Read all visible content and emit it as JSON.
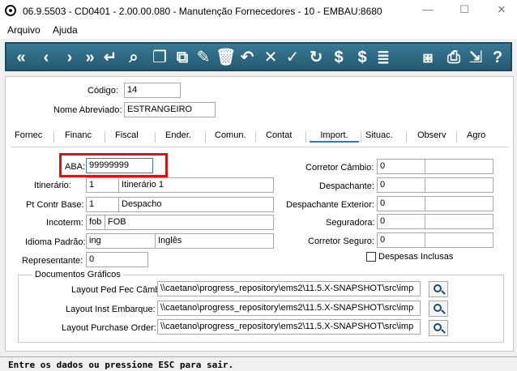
{
  "window": {
    "title": "06.9.5503 - CD0401 - 2.00.00.080 - Manutenção Fornecedores - 10 - EMBAU:8680",
    "minimize": "—",
    "maximize": "☐",
    "close": "✕"
  },
  "menu": {
    "file": "Arquivo",
    "help": "Ajuda"
  },
  "toolbar": {
    "buttons": [
      {
        "icon": "first-record-icon",
        "glyph": "«"
      },
      {
        "icon": "previous-record-icon",
        "glyph": "‹"
      },
      {
        "icon": "next-record-icon",
        "glyph": "›"
      },
      {
        "icon": "last-record-icon",
        "glyph": "»"
      },
      {
        "icon": "goto-icon",
        "glyph": "↵"
      },
      {
        "icon": "search-icon",
        "glyph": "⌕"
      },
      {
        "icon": "add-icon",
        "glyph": "❐"
      },
      {
        "icon": "copy-icon",
        "glyph": "⧉"
      },
      {
        "icon": "edit-icon",
        "glyph": "✎"
      },
      {
        "icon": "delete-icon",
        "glyph": "🗑"
      },
      {
        "icon": "undo-icon",
        "glyph": "↶"
      },
      {
        "icon": "cancel-icon",
        "glyph": "✕"
      },
      {
        "icon": "save-icon",
        "glyph": "✓"
      },
      {
        "icon": "history-icon",
        "glyph": "↻"
      },
      {
        "icon": "currency-icon",
        "glyph": "$"
      },
      {
        "icon": "dollar-icon",
        "glyph": "$"
      },
      {
        "icon": "list-icon",
        "glyph": "≣"
      },
      {
        "icon": "network-icon",
        "glyph": "⧆"
      },
      {
        "icon": "print-icon",
        "glyph": "⎙"
      },
      {
        "icon": "exit-icon",
        "glyph": "⇲"
      },
      {
        "icon": "help-icon",
        "glyph": "?"
      }
    ]
  },
  "header": {
    "codigo_label": "Código:",
    "codigo_value": "14",
    "nome_label": "Nome Abreviado:",
    "nome_value": "ESTRANGEIRO"
  },
  "tabs": [
    "Fornec",
    "Financ",
    "Fiscal",
    "Ender.",
    "Comun.",
    "Contat",
    "Import.",
    "Situac.",
    "Observ",
    "Agro"
  ],
  "active_tab": "Import.",
  "import": {
    "aba_label": "ABA:",
    "aba_value": "99999999",
    "itinerario_label": "Itinerário:",
    "itinerario_value": "1",
    "itinerario_desc": "Itinerário 1",
    "pt_contr_base_label": "Pt Contr Base:",
    "pt_contr_base_value": "1",
    "pt_contr_base_desc": "Despacho",
    "incoterm_label": "Incoterm:",
    "incoterm_value": "fob",
    "incoterm_desc": "FOB",
    "idioma_label": "Idioma Padrão:",
    "idioma_value": "ing",
    "idioma_desc": "Inglês",
    "representante_label": "Representante:",
    "representante_value": "0",
    "corretor_cambio_label": "Corretor Câmbio:",
    "corretor_cambio_value": "0",
    "despachante_label": "Despachante:",
    "despachante_value": "0",
    "despachante_ext_label": "Despachante Exterior:",
    "despachante_ext_value": "0",
    "seguradora_label": "Seguradora:",
    "seguradora_value": "0",
    "corretor_seguro_label": "Corretor Seguro:",
    "corretor_seguro_value": "0",
    "despesas_label": "Despesas Inclusas",
    "docs_group_title": "Documentos Gráficos",
    "layout_ped_label": "Layout Ped Fec Câmbio:",
    "layout_ped_value": "\\\\caetano\\progress_repository\\ems2\\11.5.X-SNAPSHOT\\src\\imp",
    "layout_inst_label": "Layout Inst Embarque:",
    "layout_inst_value": "\\\\caetano\\progress_repository\\ems2\\11.5.X-SNAPSHOT\\src\\imp",
    "layout_purchase_label": "Layout Purchase Order:",
    "layout_purchase_value": "\\\\caetano\\progress_repository\\ems2\\11.5.X-SNAPSHOT\\src\\imp"
  },
  "status": "Entre os dados ou pressione ESC para sair."
}
